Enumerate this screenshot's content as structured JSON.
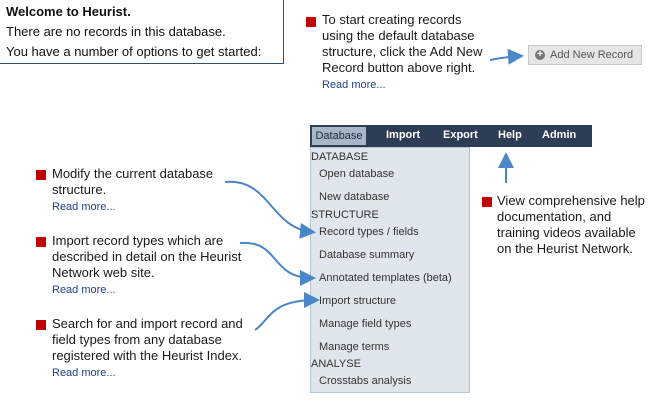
{
  "welcome": {
    "title": "Welcome to Heurist.",
    "line1": "There are no records in this database.",
    "line2": "You have a number of options to get started:"
  },
  "notes": {
    "start": [
      "To start creating records",
      "using the default database",
      "structure, click the Add New",
      "Record button above right."
    ],
    "modify": [
      "Modify the current database",
      "structure."
    ],
    "import": [
      "Import record types which are",
      "described in detail on the Heurist",
      "Network web site."
    ],
    "search": [
      "Search for and import record and",
      "field types from any database",
      "registered with the Heurist Index."
    ],
    "help": [
      "View comprehensive help",
      "documentation, and",
      "training videos available",
      "on the Heurist Network."
    ],
    "read_more": "Read more..."
  },
  "add_button": {
    "label": "Add New Record",
    "icon": "plus-circle-icon"
  },
  "menubar": {
    "items": [
      "Database",
      "Import",
      "Export",
      "Help",
      "Admin"
    ]
  },
  "dropdown": {
    "sections": [
      "DATABASE",
      "STRUCTURE",
      "ANALYSE"
    ],
    "items": [
      "Open database",
      "New database",
      "Record types / fields",
      "Database summary",
      "Annotated templates (beta)",
      "Import structure",
      "Manage field types",
      "Manage terms",
      "Crosstabs analysis"
    ]
  },
  "colors": {
    "bullet": "#c00000",
    "menubar": "#2c3d55",
    "arrow": "#4a86c8",
    "dropdown_bg": "#dfe6ee"
  }
}
